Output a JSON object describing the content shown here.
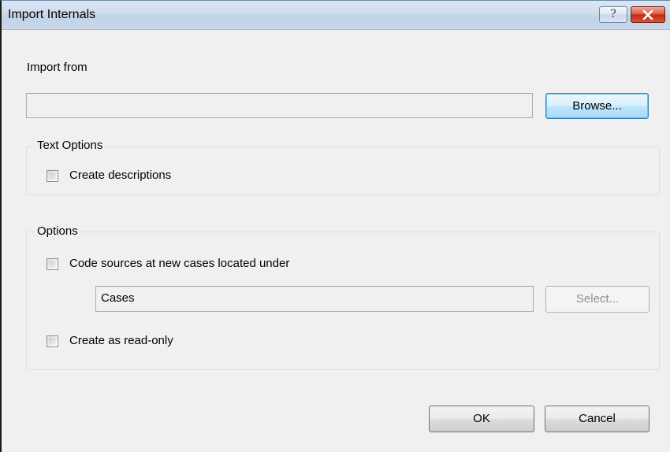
{
  "window": {
    "title": "Import Internals",
    "help_glyph": "?",
    "close_icon": "close-icon"
  },
  "import_from": {
    "label": "Import from",
    "value": "",
    "browse_label": "Browse..."
  },
  "text_options": {
    "legend": "Text Options",
    "create_descriptions_label": "Create descriptions",
    "create_descriptions_checked": false
  },
  "options": {
    "legend": "Options",
    "code_sources_label": "Code sources at new cases located under",
    "code_sources_checked": false,
    "cases_value": "Cases",
    "select_label": "Select...",
    "read_only_label": "Create as read-only",
    "read_only_checked": false
  },
  "footer": {
    "ok_label": "OK",
    "cancel_label": "Cancel"
  },
  "colors": {
    "title_bar": "#cfdcec",
    "close_button": "#c22c10",
    "default_button": "#bee6fd",
    "dialog_bg": "#f0f0f0"
  }
}
